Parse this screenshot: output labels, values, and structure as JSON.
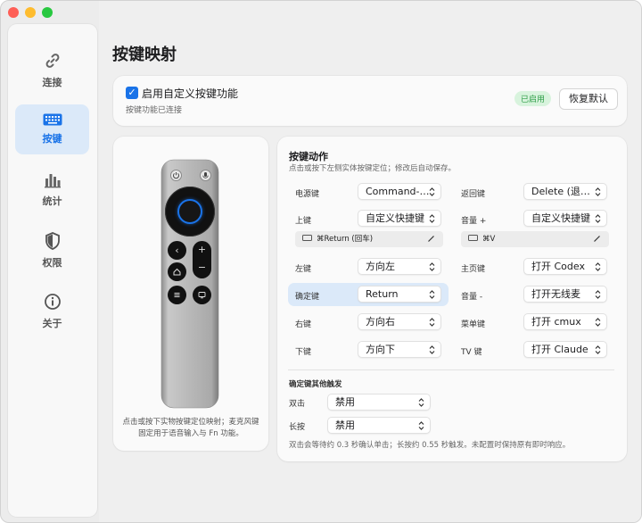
{
  "sidebar": {
    "items": [
      {
        "label": "连接",
        "icon": "link-icon"
      },
      {
        "label": "按键",
        "icon": "keyboard-icon",
        "active": true
      },
      {
        "label": "统计",
        "icon": "bar-chart-icon"
      },
      {
        "label": "权限",
        "icon": "shield-icon"
      },
      {
        "label": "关于",
        "icon": "info-icon"
      }
    ]
  },
  "page": {
    "title": "按键映射"
  },
  "toggle": {
    "label": "启用自定义按键功能",
    "checked": true,
    "status": "按键功能已连接",
    "badge": "已启用",
    "reset_label": "恢复默认"
  },
  "remote": {
    "note": "点击或按下实物按键定位映射；麦克风键固定用于语音输入与 Fn 功能。"
  },
  "actions": {
    "title": "按键动作",
    "subtitle": "点击或按下左侧实体按键定位；修改后自动保存。",
    "left": [
      {
        "label": "电源键",
        "value": "Command-…"
      },
      {
        "label": "上键",
        "value": "自定义快捷键",
        "shortcut": "⌘Return (回车)"
      },
      {
        "label": "左键",
        "value": "方向左"
      },
      {
        "label": "确定键",
        "value": "Return",
        "highlighted": true
      },
      {
        "label": "右键",
        "value": "方向右"
      },
      {
        "label": "下键",
        "value": "方向下"
      }
    ],
    "right": [
      {
        "label": "返回键",
        "value": "Delete (退…"
      },
      {
        "label": "音量 +",
        "value": "自定义快捷键",
        "shortcut": "⌘V"
      },
      {
        "label": "主页键",
        "value": "打开 Codex"
      },
      {
        "label": "音量 -",
        "value": "打开无线麦"
      },
      {
        "label": "菜单键",
        "value": "打开 cmux"
      },
      {
        "label": "TV 键",
        "value": "打开 Claude"
      }
    ]
  },
  "confirm_extra": {
    "title": "确定键其他触发",
    "double_label": "双击",
    "double_value": "禁用",
    "long_label": "长按",
    "long_value": "禁用",
    "note": "双击会等待约 0.3 秒确认单击；长按约 0.55 秒触发。未配置时保持原有即时响应。"
  },
  "colors": {
    "accent": "#1a73e8",
    "active_bg": "#dbe9f9",
    "badge_bg": "#d8f3dd",
    "badge_text": "#2e9e47"
  }
}
